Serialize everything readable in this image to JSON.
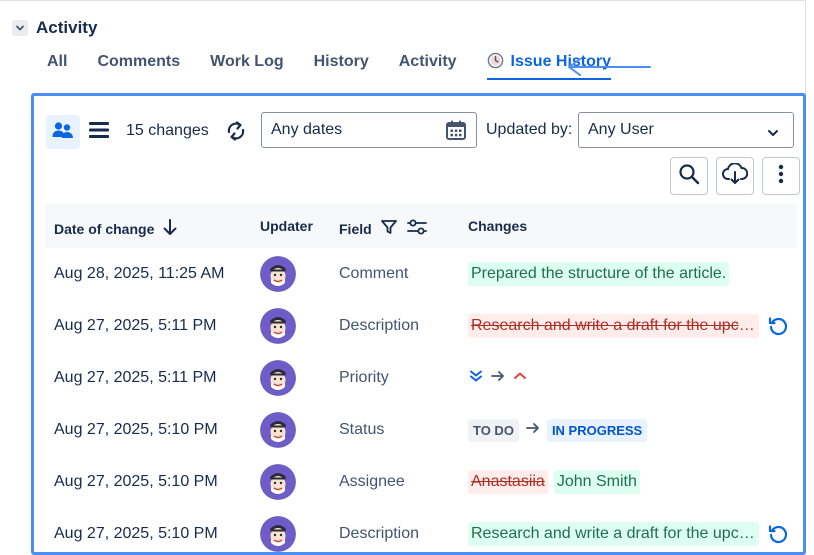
{
  "activity": {
    "title": "Activity"
  },
  "tabs": [
    {
      "label": "All"
    },
    {
      "label": "Comments"
    },
    {
      "label": "Work Log"
    },
    {
      "label": "History"
    },
    {
      "label": "Activity"
    },
    {
      "label": "Issue History",
      "active": true
    }
  ],
  "toolbar": {
    "changes_count": "15 changes",
    "date_filter": "Any dates",
    "updated_by_label": "Updated by:",
    "user_filter": "Any User"
  },
  "table": {
    "headers": {
      "date": "Date of change",
      "updater": "Updater",
      "field": "Field",
      "changes": "Changes"
    },
    "rows": [
      {
        "date": "Aug 28, 2025, 11:25 AM",
        "field": "Comment",
        "added": "Prepared the structure of the article."
      },
      {
        "date": "Aug 27, 2025, 5:11 PM",
        "field": "Description",
        "removed": "Research and write a draft for the upco..."
      },
      {
        "date": "Aug 27, 2025, 5:11 PM",
        "field": "Priority",
        "priority_from": "lowest-icon",
        "priority_to": "high-icon"
      },
      {
        "date": "Aug 27, 2025, 5:10 PM",
        "field": "Status",
        "status_from": "TO DO",
        "status_to": "IN PROGRESS"
      },
      {
        "date": "Aug 27, 2025, 5:10 PM",
        "field": "Assignee",
        "removed": "Anastasiia",
        "added": "John Smith"
      },
      {
        "date": "Aug 27, 2025, 5:10 PM",
        "field": "Description",
        "added": "Research and write a draft for the upco..."
      }
    ]
  },
  "colors": {
    "accent": "#0c66e4",
    "panel_border": "#4c8ef5",
    "avatar_bg": "#6e5dc6",
    "added_bg": "#dcfff1",
    "removed_bg": "#ffeceb"
  }
}
